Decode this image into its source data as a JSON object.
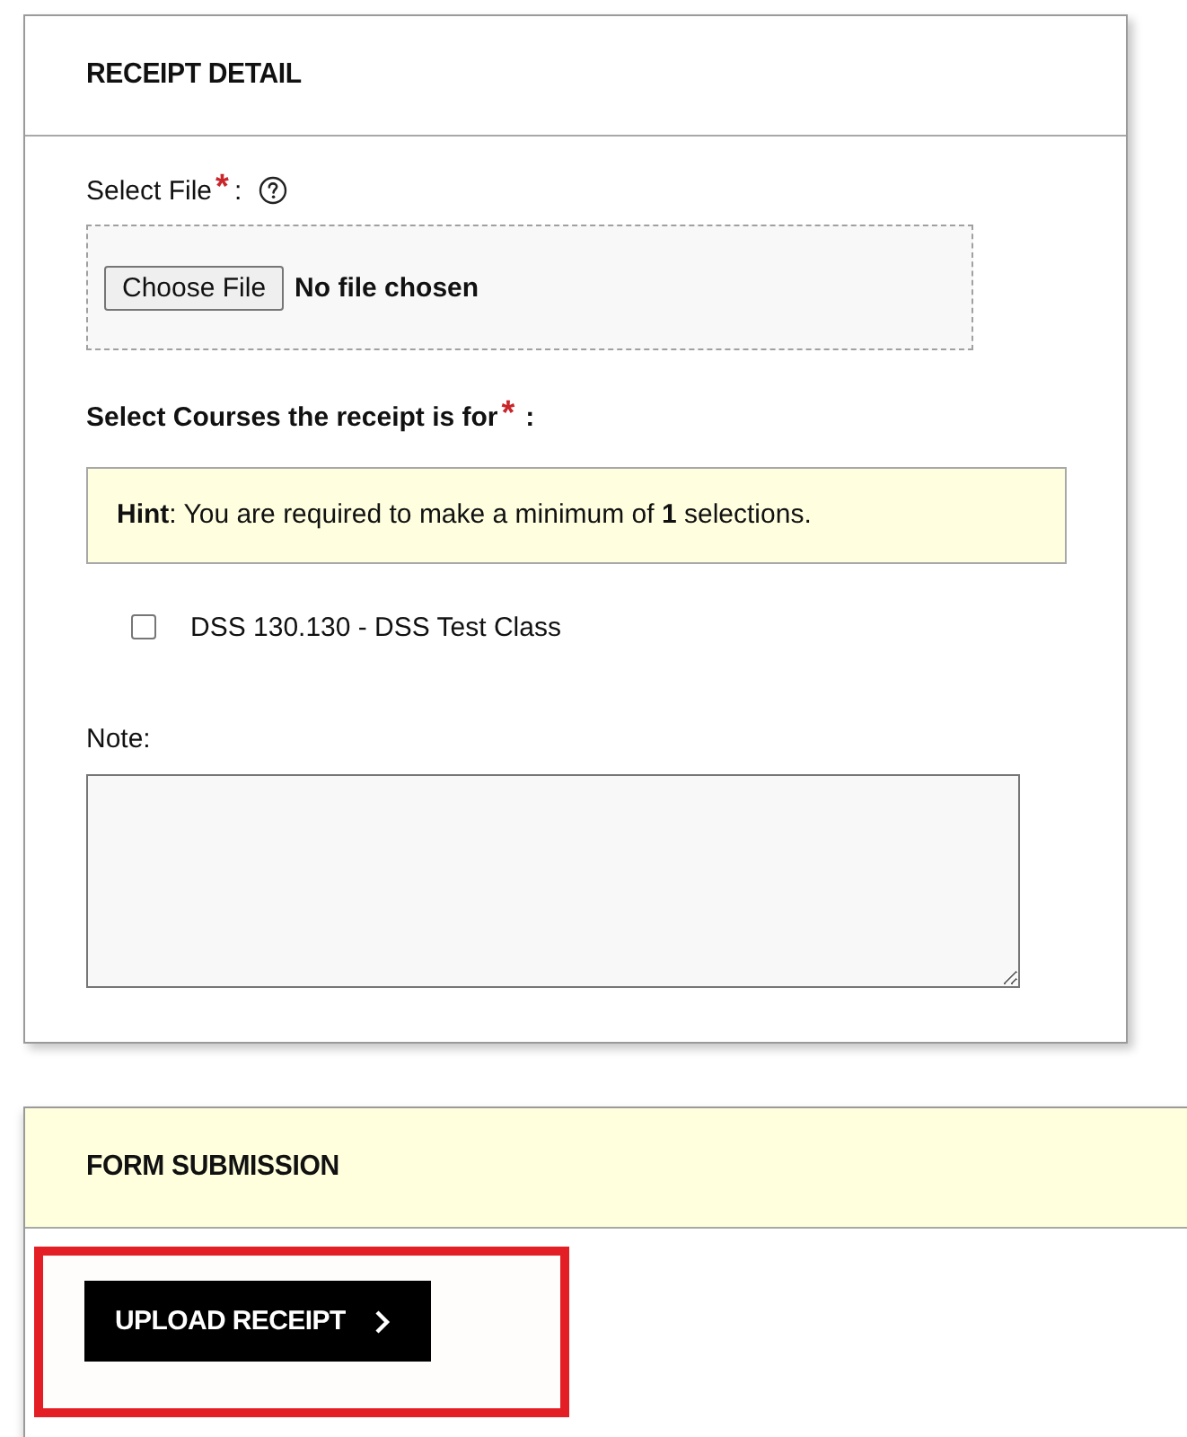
{
  "receipt_detail": {
    "title": "RECEIPT DETAIL",
    "file_field": {
      "label": "Select File",
      "required_mark": "*",
      "colon": ":",
      "button": "Choose File",
      "status": "No file chosen"
    },
    "courses_field": {
      "label": "Select Courses the receipt is for",
      "required_mark": "*",
      "colon": ":",
      "hint": "**Hint**: You are required to make a minimum of **1** selections.",
      "options": [
        {
          "label": "DSS 130.130 - DSS Test Class",
          "checked": false
        }
      ]
    },
    "note_field": {
      "label": "Note:"
    }
  },
  "form_submission": {
    "title": "FORM SUBMISSION",
    "button": {
      "label": "UPLOAD RECEIPT",
      "highlighted": true
    }
  }
}
